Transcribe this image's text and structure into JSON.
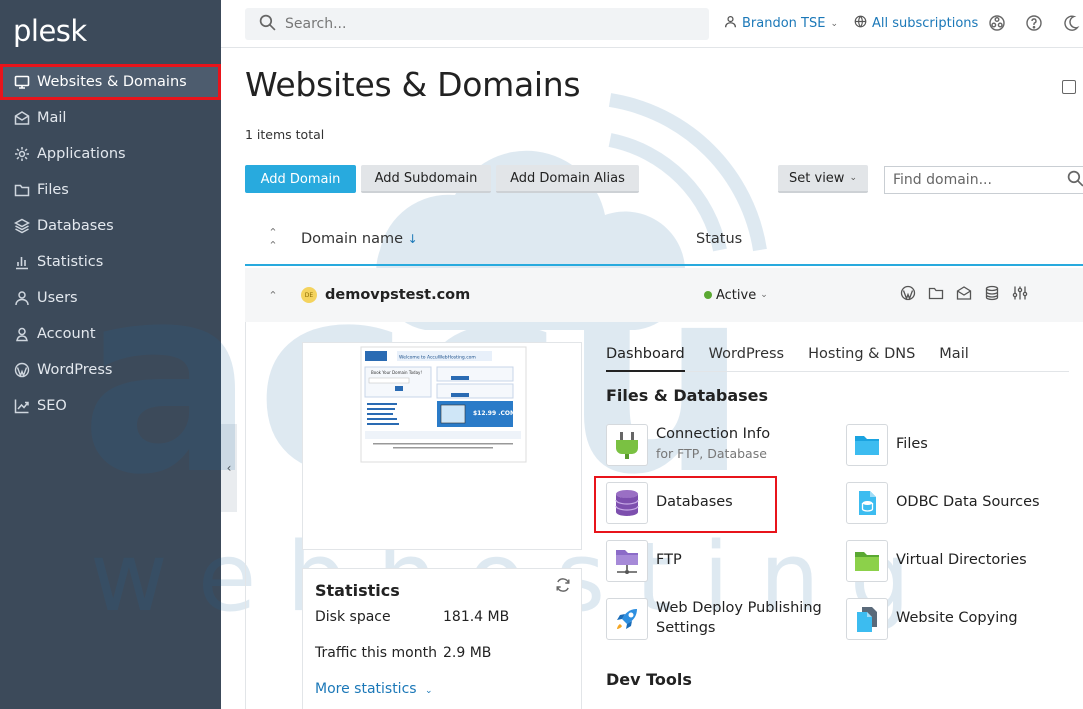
{
  "brand": {
    "logo_text": "plesk"
  },
  "sidebar": {
    "items": [
      {
        "label": "Websites & Domains",
        "icon": "monitor-icon"
      },
      {
        "label": "Mail",
        "icon": "mail-icon"
      },
      {
        "label": "Applications",
        "icon": "gear-icon"
      },
      {
        "label": "Files",
        "icon": "folder-icon"
      },
      {
        "label": "Databases",
        "icon": "layers-icon"
      },
      {
        "label": "Statistics",
        "icon": "bar-chart-icon"
      },
      {
        "label": "Users",
        "icon": "user-icon"
      },
      {
        "label": "Account",
        "icon": "person-icon"
      },
      {
        "label": "WordPress",
        "icon": "wordpress-icon"
      },
      {
        "label": "SEO",
        "icon": "trend-icon"
      }
    ]
  },
  "topbar": {
    "search_placeholder": "Search...",
    "user_label": "Brandon TSE",
    "subscriptions_label": "All subscriptions"
  },
  "page": {
    "title": "Websites & Domains",
    "total_text": "1 items total"
  },
  "toolbar": {
    "add_domain": "Add Domain",
    "add_subdomain": "Add Subdomain",
    "add_alias": "Add Domain Alias",
    "set_view": "Set view",
    "find_placeholder": "Find domain..."
  },
  "table": {
    "col_domain": "Domain name",
    "col_status": "Status"
  },
  "domain": {
    "name": "demovpstest.com",
    "favicon_text": "DE",
    "status": "Active"
  },
  "preview": {
    "site_title": "Welcome to AccuWebHosting.com",
    "box_title": "Book Your Domain Today!",
    "price_text": "$12.99 .COM"
  },
  "stats": {
    "title": "Statistics",
    "disk_label": "Disk space",
    "disk_value": "181.4 MB",
    "traffic_label": "Traffic this month",
    "traffic_value": "2.9 MB",
    "more_label": "More statistics"
  },
  "tabs": [
    "Dashboard",
    "WordPress",
    "Hosting & DNS",
    "Mail"
  ],
  "sections": {
    "files_db": "Files & Databases",
    "dev_tools": "Dev Tools"
  },
  "tools": [
    {
      "label": "Connection Info",
      "sub": "for FTP, Database",
      "icon": "plug-icon"
    },
    {
      "label": "Files",
      "sub": "",
      "icon": "folder-icon"
    },
    {
      "label": "Databases",
      "sub": "",
      "icon": "database-icon"
    },
    {
      "label": "ODBC Data Sources",
      "sub": "",
      "icon": "odbc-icon"
    },
    {
      "label": "FTP",
      "sub": "",
      "icon": "ftp-icon"
    },
    {
      "label": "Virtual Directories",
      "sub": "",
      "icon": "virtual-directory-icon"
    },
    {
      "label": "Web Deploy Publishing",
      "label2": "Settings",
      "icon": "rocket-icon"
    },
    {
      "label": "Website Copying",
      "sub": "",
      "icon": "copy-icon"
    }
  ],
  "watermark": {
    "line1": "accu",
    "line2": "w e b   h o s t i n g"
  },
  "colors": {
    "sidebar_bg": "#3c4a5a",
    "accent": "#28aade",
    "highlight": "#e8141b",
    "active_status": "#5aa832"
  }
}
